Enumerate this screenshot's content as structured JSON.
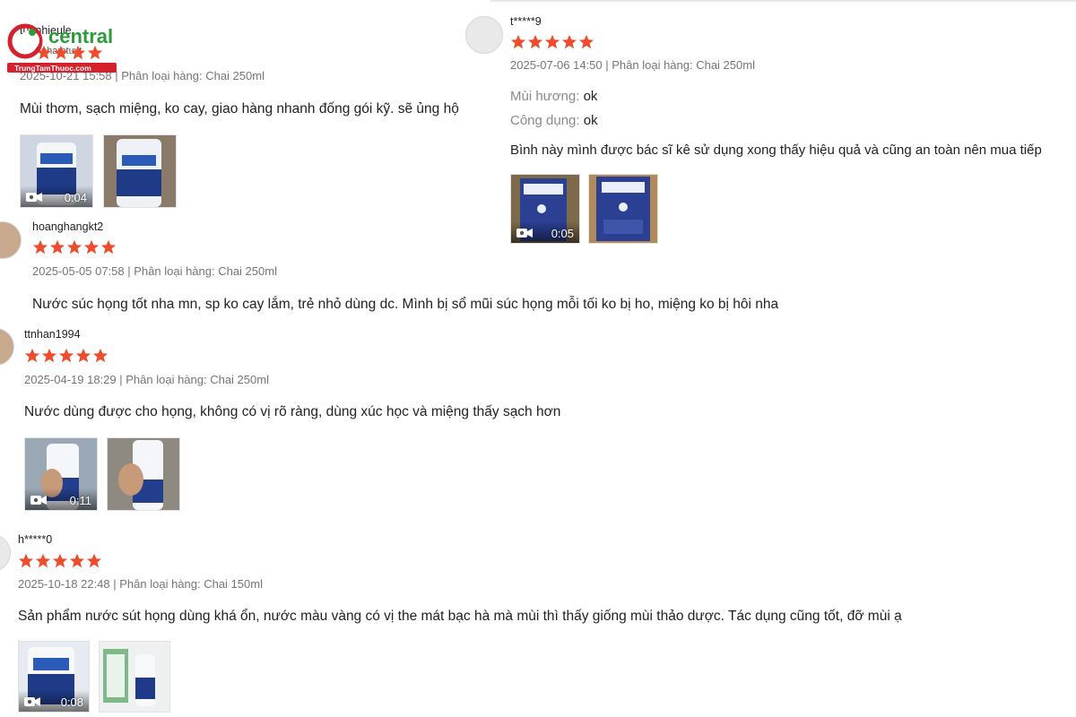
{
  "brand": {
    "name": "central",
    "url": "TrungTamThuoc.com",
    "accent": "#d4212c",
    "green": "#2e9b3a"
  },
  "colors": {
    "star": "#ee4d2d"
  },
  "reviews": [
    {
      "username": "tuanhieule",
      "sub_username": "phamtuyt",
      "rating": 5,
      "meta": "2025-10-21 15:58 | Phân loại hàng: Chai 250ml",
      "body": "Mùi thơm, sạch miệng, ko cay, giao hàng nhanh đống gói kỹ. sẽ ủng hộ",
      "video_duration": "0:04"
    },
    {
      "username": "t*****9",
      "rating": 5,
      "meta": "2025-07-06 14:50 | Phân loại hàng: Chai 250ml",
      "attr1_label": "Mùi hương:",
      "attr1_value": "ok",
      "attr2_label": "Công dụng:",
      "attr2_value": "ok",
      "body": "Bình này mình được bác sĩ kê sử dụng xong thấy hiệu quả và cũng an toàn nên mua tiếp",
      "video_duration": "0:05"
    },
    {
      "username": "hoanghangkt2",
      "rating": 5,
      "meta": "2025-05-05 07:58 | Phân loại hàng: Chai 250ml",
      "body": "Nước súc họng tốt nha mn, sp ko cay lắm, trẻ nhỏ dùng dc. Mình bị sổ mũi súc họng mỗi tối ko bị ho, miệng ko bị hôi nha"
    },
    {
      "username": "ttnhan1994",
      "rating": 5,
      "meta": "2025-04-19 18:29 | Phân loại hàng: Chai 250ml",
      "body": "Nước dùng được cho họng, không có vị rõ ràng, dùng xúc học và miệng thấy sạch hơn",
      "video_duration": "0:11"
    },
    {
      "username": "h*****0",
      "rating": 5,
      "meta": "2025-10-18 22:48 | Phân loại hàng: Chai 150ml",
      "body": "Sản phẩm nước sút họng dùng khá ổn, nước màu vàng có vị the mát bạc hà mà mùi thì thấy giống mùi thảo dược. Tác dụng cũng tốt, đỡ mùi ạ",
      "video_duration": "0:08"
    }
  ]
}
